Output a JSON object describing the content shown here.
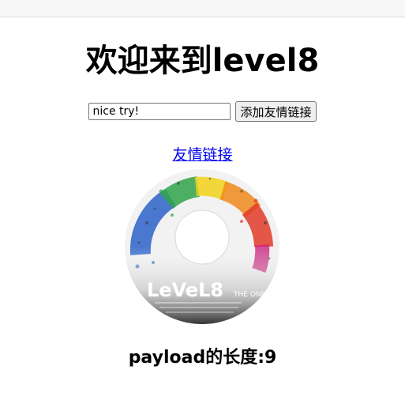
{
  "page": {
    "title": "欢迎来到level8",
    "input_value": "nice try!",
    "submit_label": "添加友情链接",
    "link_text": "友情链接",
    "payload_text": "payload的长度:9"
  },
  "disc": {
    "logo_text": "LeVeL8",
    "logo_sub": "THE ONE"
  },
  "colors": {
    "link": "#0000ee",
    "button_bg": "#efefef"
  }
}
